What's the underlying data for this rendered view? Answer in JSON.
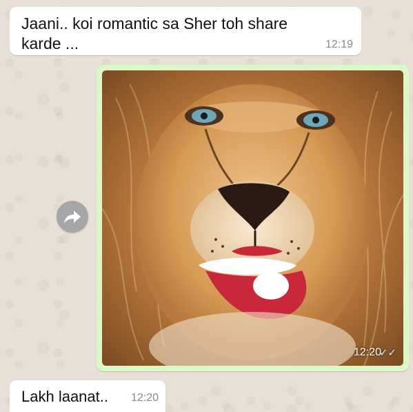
{
  "chat": {
    "messages": [
      {
        "text": "Jaani.. koi romantic sa Sher toh share karde ...",
        "time": "12:19"
      },
      {
        "image": "lion-face-photo",
        "time": "12:20",
        "status_icon": "double-tick-icon"
      },
      {
        "text": "Lakh laanat..",
        "time": "12:20"
      }
    ]
  },
  "icons": {
    "forward": "forward-arrow-icon",
    "status": "double-tick-icon"
  },
  "colors": {
    "incoming_bubble": "#ffffff",
    "outgoing_bubble": "#dcf8c6",
    "background": "#ece5dd",
    "timestamp": "#8a8a8a",
    "forward_button": "#a6a6a6"
  }
}
